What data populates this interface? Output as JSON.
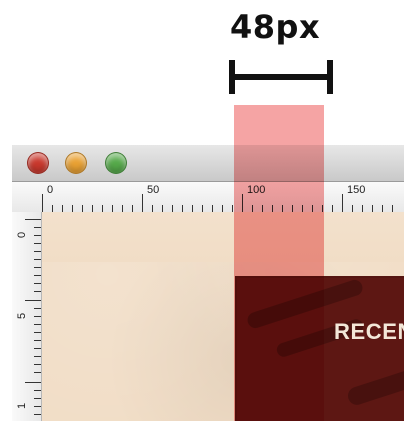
{
  "annotation": {
    "measure_label": "48px"
  },
  "window": {
    "buttons": {
      "close": "close",
      "minimize": "minimize",
      "zoom": "zoom"
    }
  },
  "rulers": {
    "top_labels": [
      "0",
      "50",
      "100",
      "150"
    ],
    "left_labels": [
      "0",
      "5",
      "1"
    ]
  },
  "canvas": {
    "heading_text": "RECENT"
  },
  "colors": {
    "highlight": "#EC5A5A",
    "canvas_bg": "#F1DDC6",
    "dark_block": "#5D1713"
  }
}
